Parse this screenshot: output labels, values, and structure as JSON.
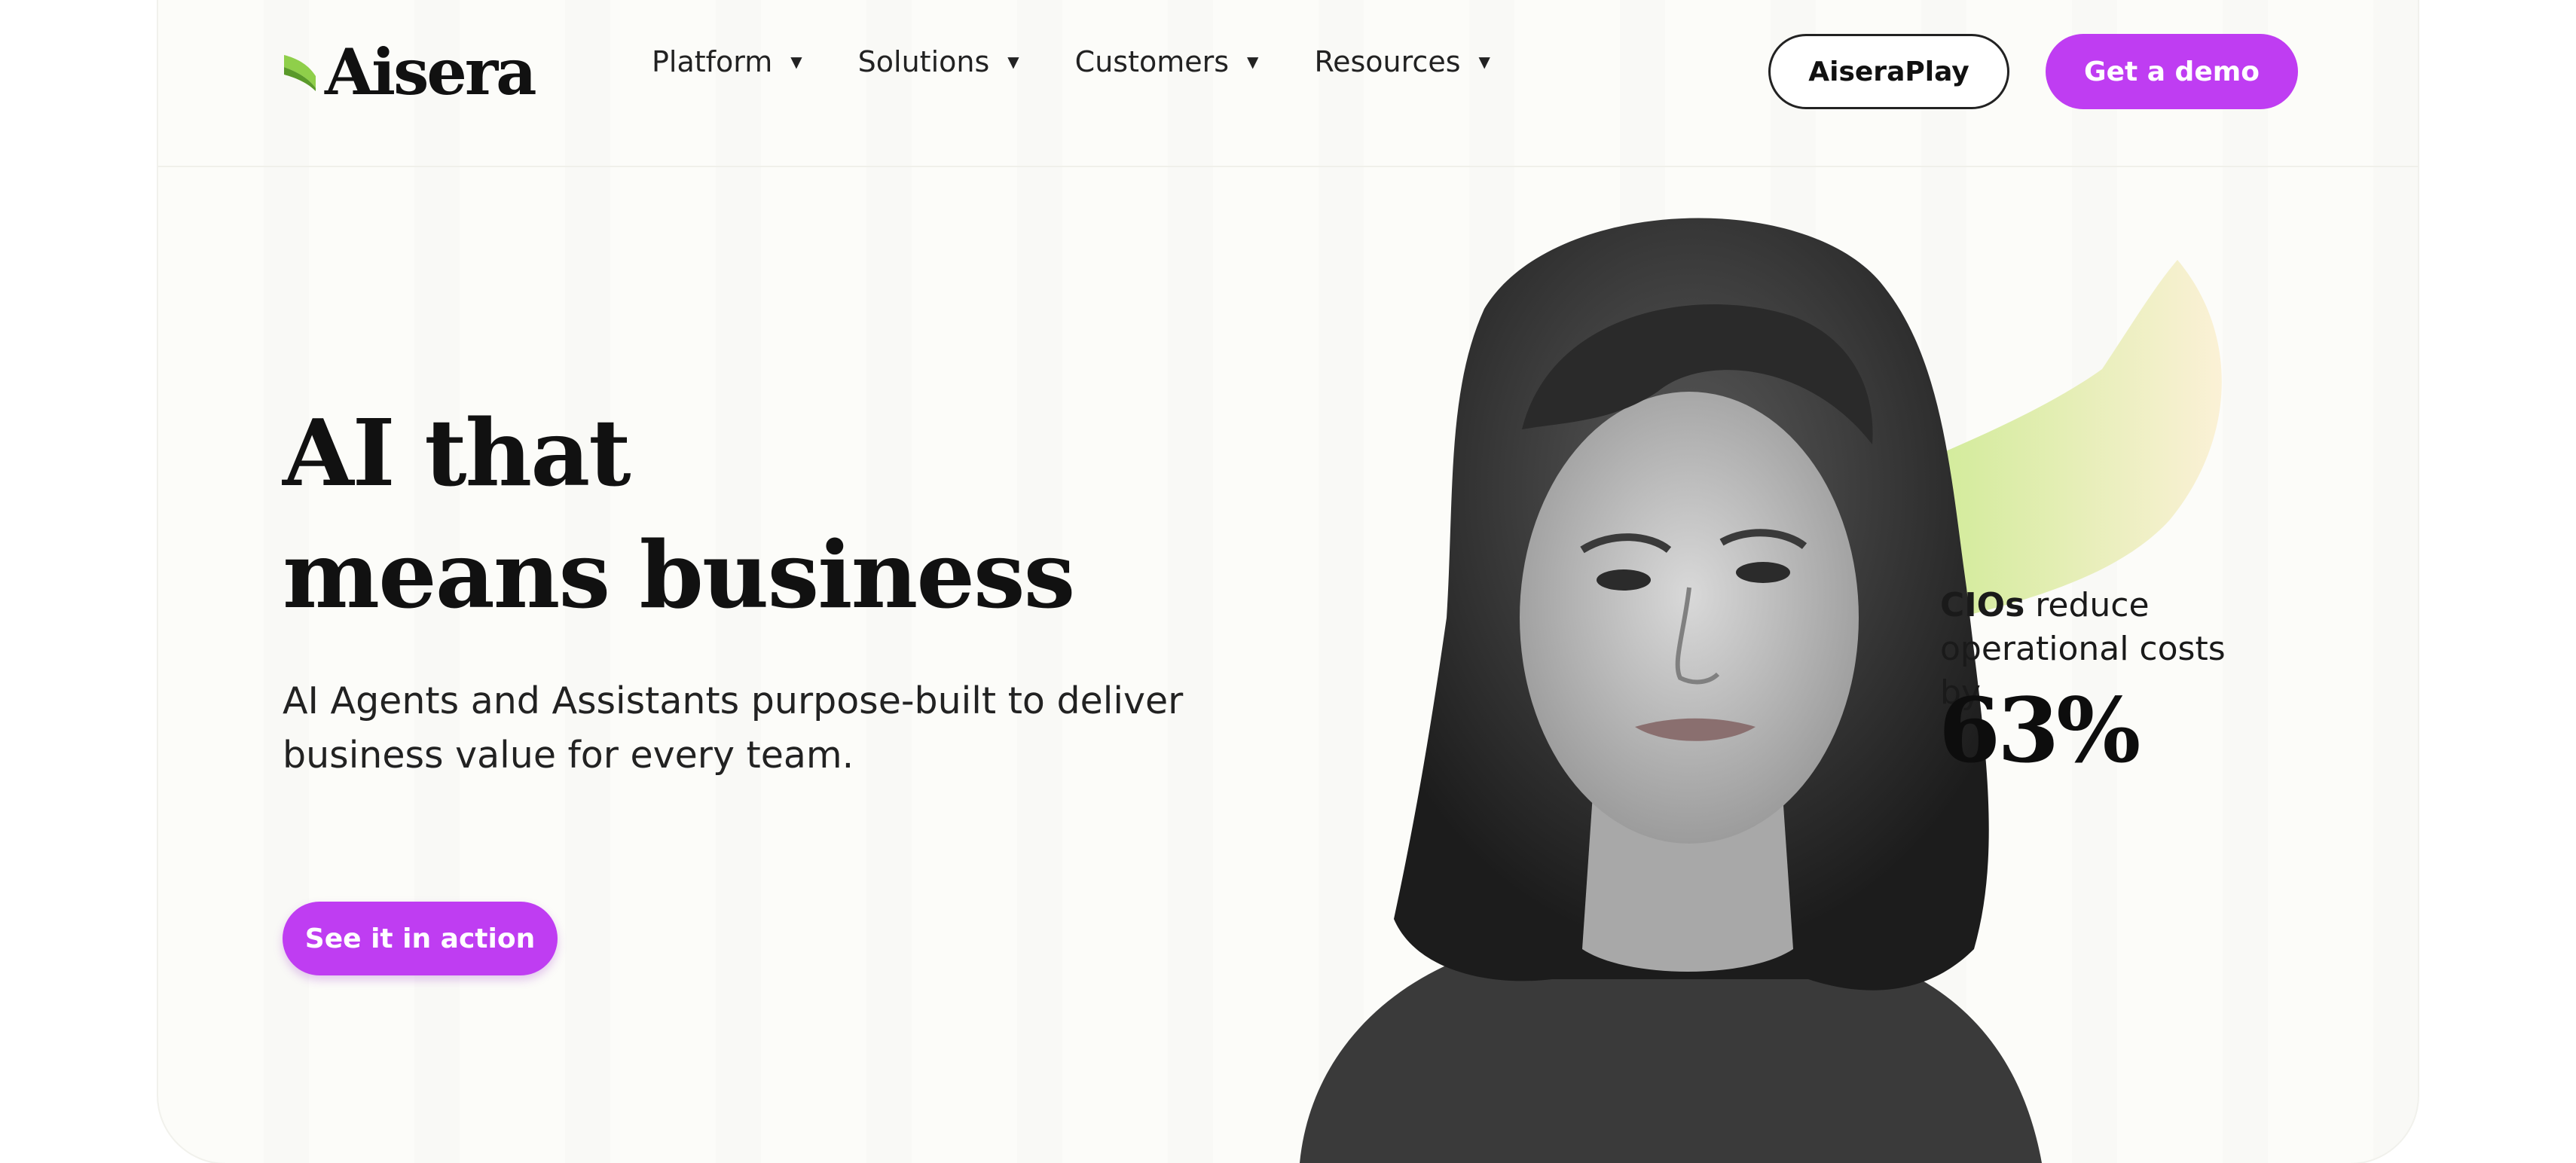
{
  "brand": {
    "name": "Aisera",
    "accent": "#bf3df2",
    "logo_green": "#8fcf4a"
  },
  "nav": {
    "items": [
      {
        "label": "Platform"
      },
      {
        "label": "Solutions"
      },
      {
        "label": "Customers"
      },
      {
        "label": "Resources"
      }
    ],
    "caret_icon": "caret-down-icon"
  },
  "header_buttons": {
    "play_label": "AiseraPlay",
    "demo_label": "Get a demo"
  },
  "hero": {
    "title_line1": "AI that",
    "title_line2": "means business",
    "subtitle": "AI Agents and Assistants purpose-built to deliver business value for every team.",
    "cta_label": "See it in action"
  },
  "stat": {
    "bold_prefix": "CIOs",
    "text": " reduce operational costs by",
    "value": "63%"
  }
}
